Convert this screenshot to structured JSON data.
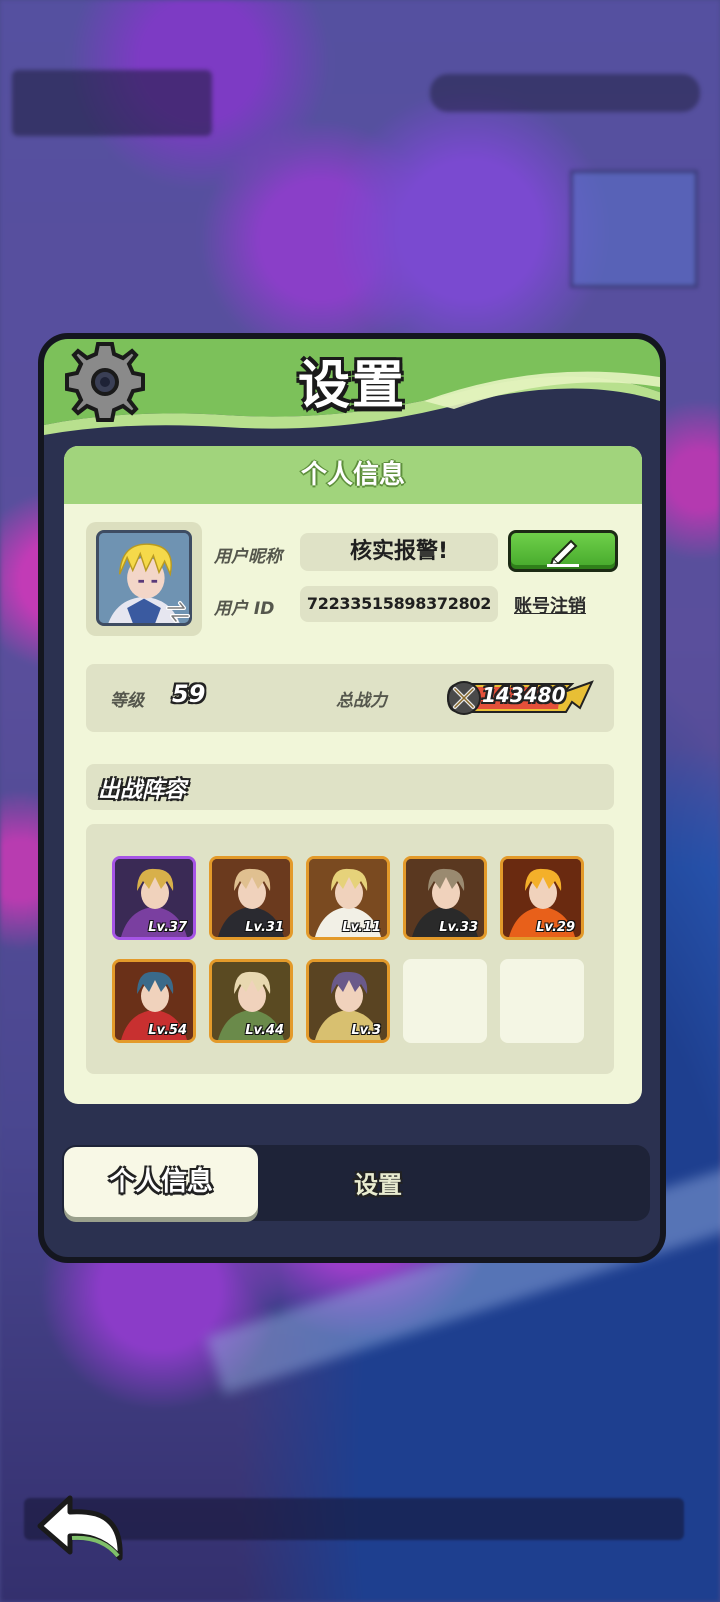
{
  "dialog": {
    "title": "设置",
    "icon": "gear-icon"
  },
  "profile_card": {
    "header": "个人信息",
    "nickname_label": "用户昵称",
    "nickname": "核实报警!",
    "id_label": "用户 ID",
    "user_id": "72233515898372802",
    "edit_icon": "pencil-icon",
    "logout_link": "账号注销",
    "level_label": "等级",
    "level": "59",
    "power_label": "总战力",
    "power": "143480"
  },
  "team": {
    "title": "出战阵容",
    "heroes": [
      {
        "lv": "Lv.37",
        "frame": "purple"
      },
      {
        "lv": "Lv.31",
        "frame": "orange"
      },
      {
        "lv": "Lv.11",
        "frame": "orange"
      },
      {
        "lv": "Lv.33",
        "frame": "orange"
      },
      {
        "lv": "Lv.29",
        "frame": "orange"
      },
      {
        "lv": "Lv.54",
        "frame": "orange"
      },
      {
        "lv": "Lv.44",
        "frame": "orange"
      },
      {
        "lv": "Lv.3",
        "frame": "orange"
      },
      {
        "lv": "",
        "frame": "empty"
      },
      {
        "lv": "",
        "frame": "empty"
      }
    ]
  },
  "tabs": [
    {
      "label": "个人信息",
      "active": true
    },
    {
      "label": "设置",
      "active": false
    }
  ],
  "colors": {
    "header_green": "#a1d47c",
    "card_bg": "#f1f6d9",
    "edit_button": "#45a82b",
    "rare_frame": "#e39a2a",
    "epic_frame": "#a655e6"
  }
}
